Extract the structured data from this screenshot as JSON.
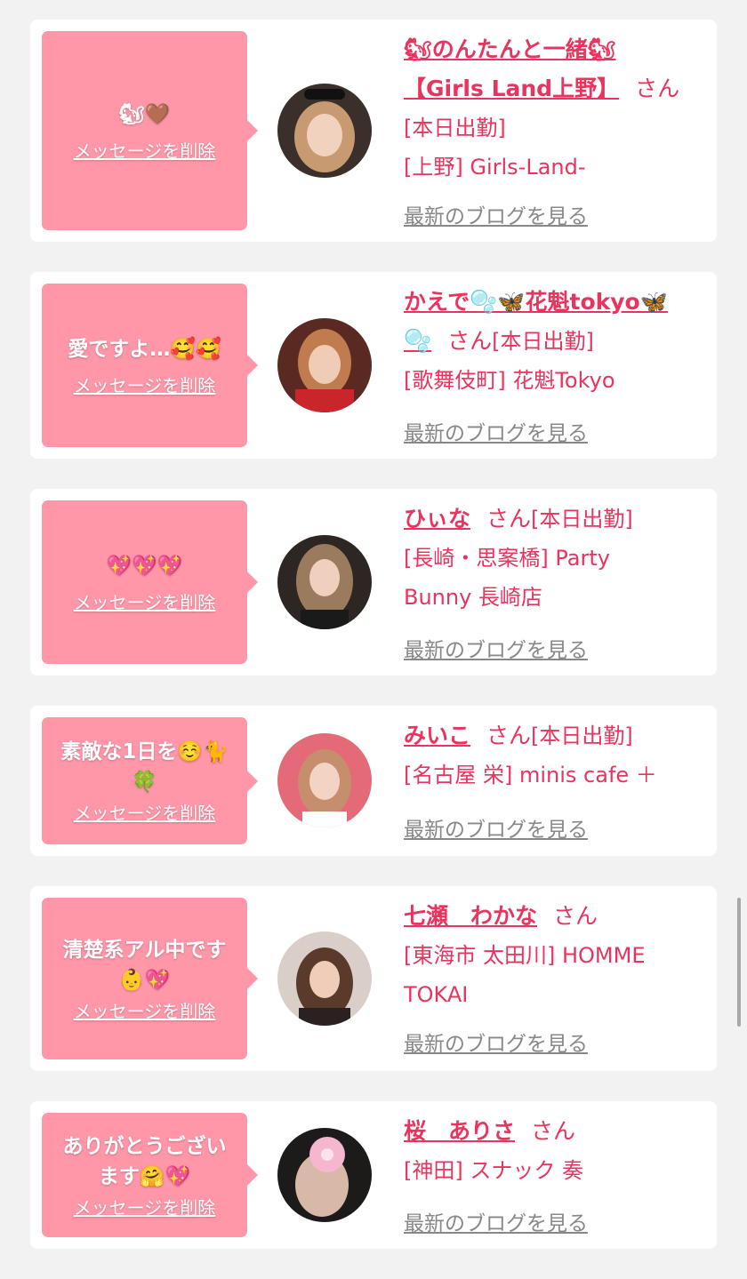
{
  "delete_label": "メッセージを削除",
  "blog_label": "最新のブログを見る",
  "san": "さん",
  "colors": {
    "accent": "#e8345e",
    "bubble": "#ff97a9",
    "background": "#f2f2f2"
  },
  "cards": [
    {
      "message": "🐿🤎",
      "name_line1": "🐿のんたんと一緒🐿",
      "name_line2": "【Girls Land上野】",
      "status": "[本日出勤]",
      "shop": "[上野] Girls-Land-"
    },
    {
      "message": "愛ですよ…🥰🥰",
      "name_line1": "かえで🫧🦋花魁tokyo🦋",
      "name_line2": "🫧",
      "status": "[本日出勤]",
      "shop": "[歌舞伎町] 花魁Tokyo"
    },
    {
      "message": "💖💖💖",
      "name": "ひぃな",
      "status": "[本日出勤]",
      "shop_line1": "[長崎・思案橋] Party",
      "shop_line2": "Bunny 長崎店"
    },
    {
      "message_line1": "素敵な1日を☺️🐈",
      "message_line2": "🍀",
      "name": "みいこ",
      "status": "[本日出勤]",
      "shop": "[名古屋 栄] minis cafe ＋"
    },
    {
      "message_line1": "清楚系アル中です",
      "message_line2": "👶💖",
      "name": "七瀬　わかな",
      "shop_line1": "[東海市 太田川] HOMME",
      "shop_line2": "TOKAI"
    },
    {
      "message_line1": "ありがとうござい",
      "message_line2": "ます🤗💖",
      "name": "桜　ありさ",
      "shop": "[神田] スナック 奏"
    }
  ]
}
